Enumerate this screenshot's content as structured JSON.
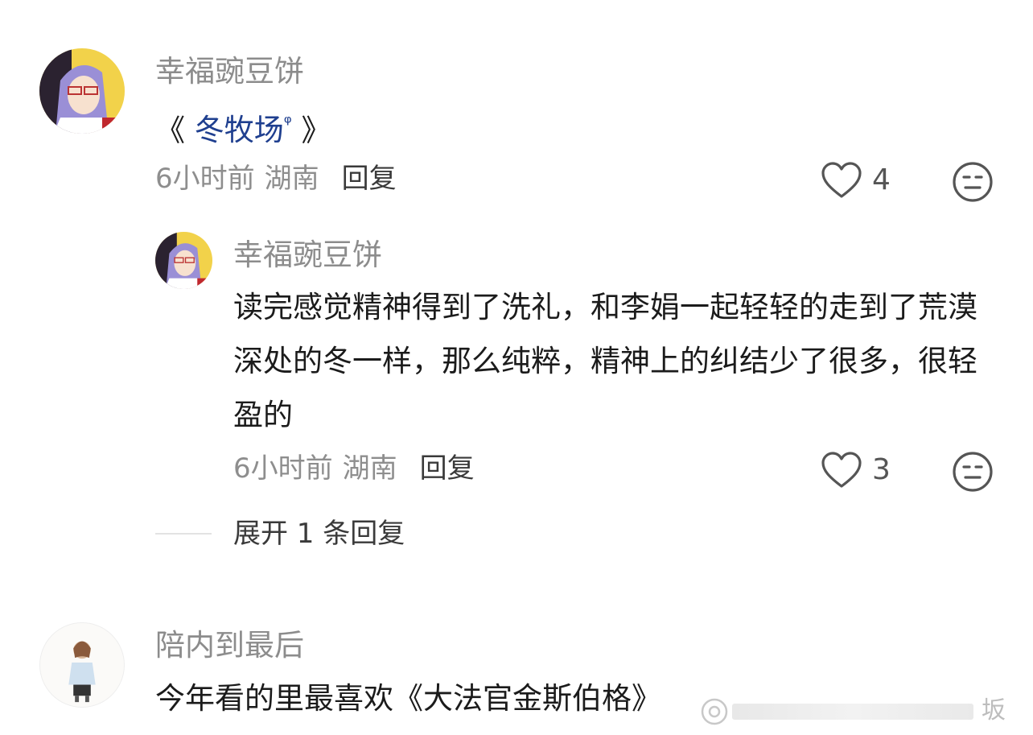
{
  "comments": [
    {
      "username": "幸福豌豆饼",
      "text_prefix": "《 ",
      "link_text": "冬牧场",
      "link_mark": "ᵠ",
      "text_suffix": " 》",
      "time": "6小时前",
      "location": "湖南",
      "reply_label": "回复",
      "likes": "4",
      "like_icon": "heart-outline-icon",
      "dislike_icon": "neutral-face-icon",
      "replies": [
        {
          "username": "幸福豌豆饼",
          "text": "读完感觉精神得到了洗礼，和李娟一起轻轻的走到了荒漠深处的冬一样，那么纯粹，精神上的纠结少了很多，很轻盈的",
          "time": "6小时前",
          "location": "湖南",
          "reply_label": "回复",
          "likes": "3"
        }
      ],
      "expand_label": "展开 1 条回复"
    },
    {
      "username": "陪内到最后",
      "text": "今年看的里最喜欢《大法官金斯伯格》"
    }
  ],
  "watermark": {
    "text": "坂"
  }
}
